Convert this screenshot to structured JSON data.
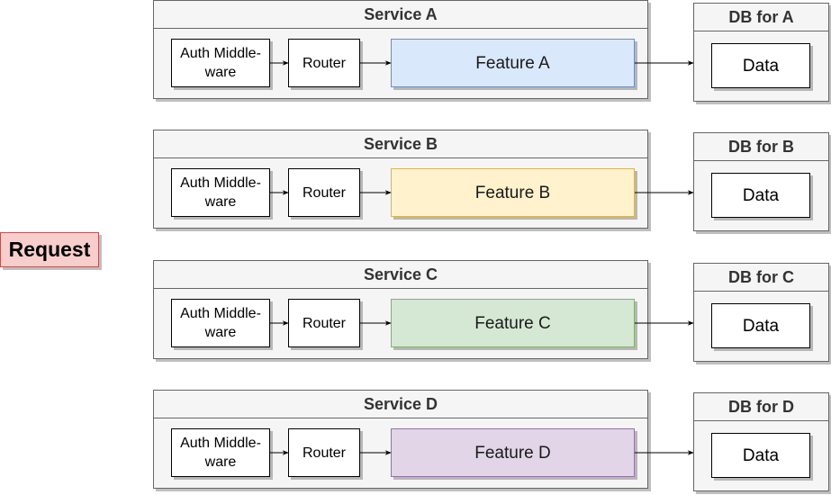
{
  "request": {
    "label": "Request",
    "fill": "#f8cecc",
    "stroke": "#b85450"
  },
  "services": [
    {
      "title": "Service A",
      "auth": "Auth Middle-ware",
      "auth_line1": "Auth Middle-",
      "auth_line2": "ware",
      "router": "Router",
      "feature": "Feature A",
      "feature_fill": "#dae8fc",
      "feature_stroke": "#6c8ebf",
      "db_title": "DB for A",
      "db_data": "Data"
    },
    {
      "title": "Service B",
      "auth": "Auth Middle-ware",
      "auth_line1": "Auth Middle-",
      "auth_line2": "ware",
      "router": "Router",
      "feature": "Feature B",
      "feature_fill": "#fff2cc",
      "feature_stroke": "#d6b656",
      "db_title": "DB for B",
      "db_data": "Data"
    },
    {
      "title": "Service C",
      "auth": "Auth Middle-ware",
      "auth_line1": "Auth Middle-",
      "auth_line2": "ware",
      "router": "Router",
      "feature": "Feature C",
      "feature_fill": "#d5e8d4",
      "feature_stroke": "#82b366",
      "db_title": "DB for C",
      "db_data": "Data"
    },
    {
      "title": "Service D",
      "auth": "Auth Middle-ware",
      "auth_line1": "Auth Middle-",
      "auth_line2": "ware",
      "router": "Router",
      "feature": "Feature D",
      "feature_fill": "#e1d5e7",
      "feature_stroke": "#9673a6",
      "db_title": "DB for D",
      "db_data": "Data"
    }
  ],
  "edges": [
    {
      "from": "auth-middleware",
      "to": "router"
    },
    {
      "from": "router",
      "to": "feature"
    },
    {
      "from": "feature",
      "to": "db-data"
    }
  ]
}
